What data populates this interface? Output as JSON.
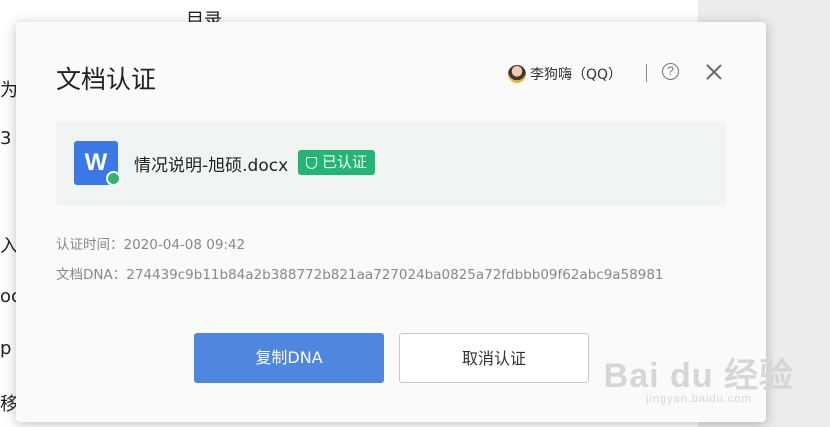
{
  "background": {
    "fragments": [
      "目录",
      "为",
      "3",
      "入",
      "oc",
      "p",
      "移"
    ],
    "watermark_main": "Bai du 经验",
    "watermark_sub": "jingyan.baidu.com"
  },
  "dialog": {
    "title": "文档认证",
    "user_name": "李狗嗨（QQ）",
    "help_glyph": "?",
    "file": {
      "icon_letter": "W",
      "name": "情况说明-旭硕.docx",
      "badge": "已认证"
    },
    "meta": {
      "time": "认证时间：2020-04-08 09:42",
      "dna": "文档DNA：274439c9b11b84a2b388772b821aa727024ba0825a72fdbbb09f62abc9a58981"
    },
    "buttons": {
      "copy": "复制DNA",
      "cancel": "取消认证"
    }
  },
  "colors": {
    "primary_button": "#4f86e0",
    "verified_badge": "#22b573",
    "file_icon": "#3b79e6"
  }
}
